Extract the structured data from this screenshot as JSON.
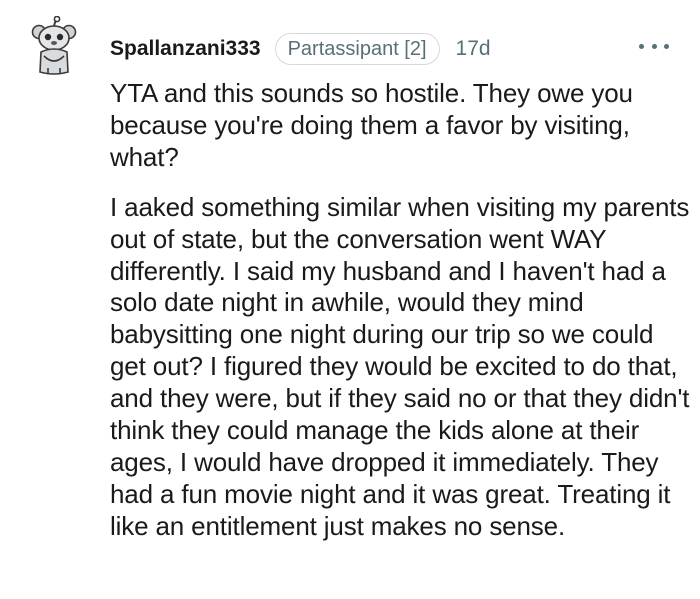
{
  "comment": {
    "avatar_icon": "snoo-avatar-icon",
    "author": "Spallanzani333",
    "flair": "Partassipant [2]",
    "age": "17d",
    "more_icon": "more-options-icon",
    "paragraphs": [
      "YTA and this sounds so hostile. They owe you because you're doing them a favor by visiting, what?",
      "I aaked something similar when visiting my parents out of state, but the conversation went WAY differently. I said my husband and I haven't had a solo date night in awhile, would they mind babysitting one night during our trip so we could get out? I figured they would be excited to do that, and they were, but if they said no or that they didn't think they could manage the kids alone at their ages, I would have dropped it immediately. They had a fun movie night and it was great. Treating it like an entitlement just makes no sense."
    ]
  }
}
